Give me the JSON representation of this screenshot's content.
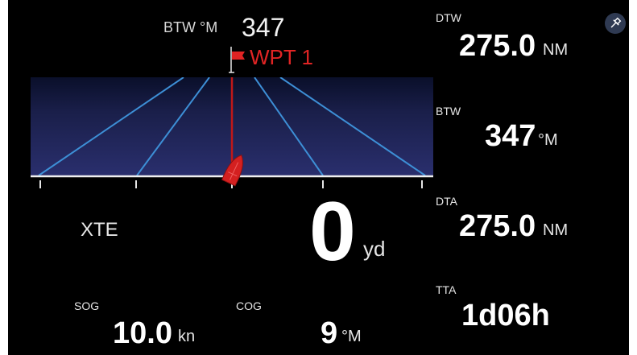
{
  "highway": {
    "btw_label": "BTW °M",
    "btw_value": "347",
    "waypoint": "WPT 1"
  },
  "xte": {
    "label": "XTE",
    "value": "0",
    "unit": "yd"
  },
  "sog": {
    "label": "SOG",
    "value": "10.0",
    "unit": "kn"
  },
  "cog": {
    "label": "COG",
    "value": "9",
    "unit": "°M"
  },
  "dtw": {
    "label": "DTW",
    "value": "275.0",
    "unit": "NM"
  },
  "btw": {
    "label": "BTW",
    "value": "347",
    "unit": "°M"
  },
  "dta": {
    "label": "DTA",
    "value": "275.0",
    "unit": "NM"
  },
  "tta": {
    "label": "TTA",
    "value": "1d06h"
  },
  "icons": {
    "pin": "pin-icon",
    "waypoint_flag": "flag-icon",
    "vessel": "boat-icon"
  },
  "colors": {
    "background": "#000000",
    "waypoint": "#e02424",
    "vessel": "#d42020",
    "road_lines": "#3d8fd6",
    "road_fill_top": "#0a0f2a",
    "road_fill_bottom": "#2a2f6e"
  }
}
